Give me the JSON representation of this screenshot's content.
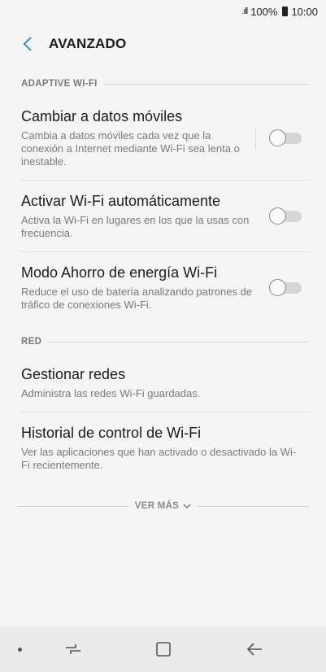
{
  "status_bar": {
    "signal": ".ıll",
    "battery_percent": "100%",
    "time": "10:00"
  },
  "header": {
    "back_icon": "chevron-left-icon",
    "title": "AVANZADO"
  },
  "sections": [
    {
      "header": "ADAPTIVE WI-FI",
      "items": [
        {
          "title": "Cambiar a datos móviles",
          "description": "Cambia a datos móviles cada vez que la conexión a Internet mediante Wi-Fi sea lenta o inestable.",
          "toggle": "off"
        },
        {
          "title": "Activar Wi-Fi automáticamente",
          "description": "Activa la Wi-Fi en lugares en los que la usas con frecuencia.",
          "toggle": "off"
        },
        {
          "title": "Modo Ahorro de energía Wi-Fi",
          "description": "Reduce el uso de batería analizando patrones de tráfico de conexiones Wi-Fi.",
          "toggle": "off"
        }
      ]
    },
    {
      "header": "RED",
      "items": [
        {
          "title": "Gestionar redes",
          "description": "Administra las redes Wi-Fi guardadas."
        },
        {
          "title": "Historial de control de Wi-Fi",
          "description": "Ver las aplicaciones que han activado o desactivado la Wi-Fi recientemente."
        }
      ]
    }
  ],
  "see_more": {
    "label": "VER MÁS",
    "icon": "chevron-down-icon"
  },
  "nav_bar": {
    "icons": [
      "dot-icon",
      "recent-apps-icon",
      "home-icon",
      "back-arrow-icon"
    ]
  },
  "colors": {
    "background": "#f5f5f5",
    "accent": "#3e8ed0",
    "toggle_track_off": "#d6d6d6",
    "nav_bar": "#eaeaea"
  }
}
